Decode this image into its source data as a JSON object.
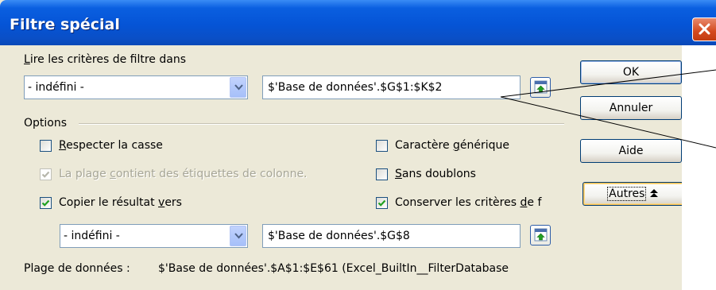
{
  "window": {
    "title": "Filtre spécial"
  },
  "criteria": {
    "label_prefix": "",
    "label_key": "L",
    "label_rest": "ire les critères de filtre dans",
    "combo_value": "- indéfini -",
    "field_value": "$'Base de données'.$G$1:$K$2"
  },
  "options": {
    "header": "Options",
    "case_key": "R",
    "case_rest": "especter la casse",
    "case_checked": false,
    "wildcard_pre": "Caractère ",
    "wildcard_key": "g",
    "wildcard_rest": "énérique",
    "wildcard_checked": false,
    "labels_pre": "La plage ",
    "labels_key": "c",
    "labels_rest": "ontient des étiquettes de colonne.",
    "labels_checked": true,
    "nodup_key": "S",
    "nodup_rest": "ans doublons",
    "nodup_checked": false,
    "copy_pre": "Copier le résultat ",
    "copy_key": "v",
    "copy_rest": "ers",
    "copy_checked": true,
    "keep_pre": "Conserver les critères ",
    "keep_key": "d",
    "keep_rest": "e f",
    "keep_checked": true,
    "output_combo_value": "- indéfini -",
    "output_field_value": "$'Base de données'.$G$8",
    "range_label": "Plage de données :",
    "range_value": "$'Base de données'.$A$1:$E$61 (Excel_BuiltIn__FilterDatabase"
  },
  "buttons": {
    "ok": "OK",
    "cancel": "Annuler",
    "help": "Aide",
    "more": "Autres",
    "more_glyph": "⯭"
  },
  "colors": {
    "titlebar": "#0554d6",
    "dialog_bg": "#ece9d8",
    "close": "#d4491e",
    "check": "#21a121"
  },
  "icons": {
    "close": "close-icon",
    "combo": "chevron-down-icon",
    "shrink": "shrink-dialog-icon",
    "more": "double-chevron-up-icon"
  }
}
